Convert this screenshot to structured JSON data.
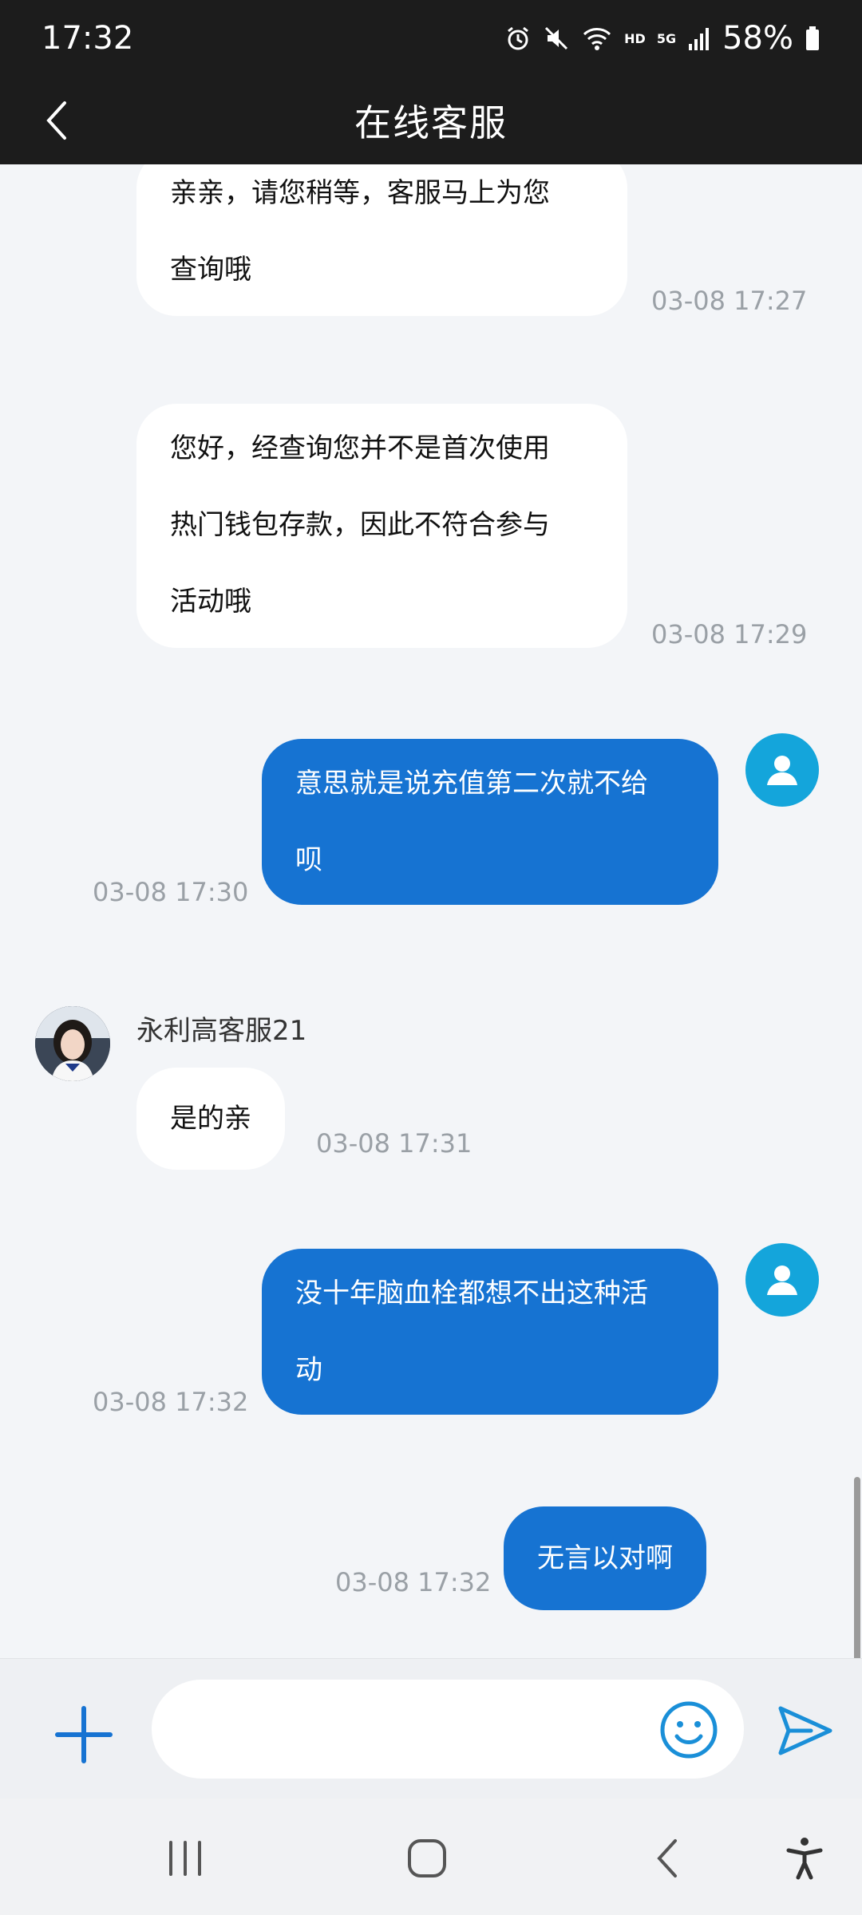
{
  "status_bar": {
    "time": "17:32",
    "battery": "58%",
    "hd_label": "HD",
    "net_label": "5G",
    "icons": [
      "alarm-icon",
      "mute-icon",
      "wifi-icon",
      "signal-icon",
      "battery-icon"
    ]
  },
  "header": {
    "title": "在线客服",
    "back_icon": "chevron-left-icon"
  },
  "messages": [
    {
      "side": "in",
      "text_lines": [
        "亲亲，请您稍等，客服马上为您",
        "查询哦"
      ],
      "time": "03-08 17:27"
    },
    {
      "side": "in",
      "text_lines": [
        "您好，经查询您并不是首次使用",
        "热门钱包存款，因此不符合参与",
        "活动哦"
      ],
      "time": "03-08 17:29"
    },
    {
      "side": "out",
      "text_lines": [
        "意思就是说充值第二次就不给",
        "呗"
      ],
      "time": "03-08 17:30"
    },
    {
      "side": "in",
      "sender": "永利高客服21",
      "text_lines": [
        "是的亲"
      ],
      "time": "03-08 17:31"
    },
    {
      "side": "out",
      "text_lines": [
        "没十年脑血栓都想不出这种活",
        "动"
      ],
      "time": "03-08 17:32"
    },
    {
      "side": "out",
      "text_lines": [
        "无言以对啊"
      ],
      "time": "03-08 17:32"
    }
  ],
  "input_bar": {
    "placeholder": "",
    "value": "",
    "icons": [
      "plus-icon",
      "emoji-icon",
      "send-icon"
    ]
  },
  "nav_bar": {
    "icons": [
      "recent-apps-icon",
      "home-icon",
      "back-icon",
      "accessibility-icon"
    ]
  },
  "colors": {
    "header_bg": "#1c1c1c",
    "outgoing_bubble": "#1673d2",
    "incoming_bubble": "#ffffff",
    "chat_bg": "#f3f5f8",
    "user_avatar": "#14a5db",
    "timestamp": "#9aa0a6"
  }
}
